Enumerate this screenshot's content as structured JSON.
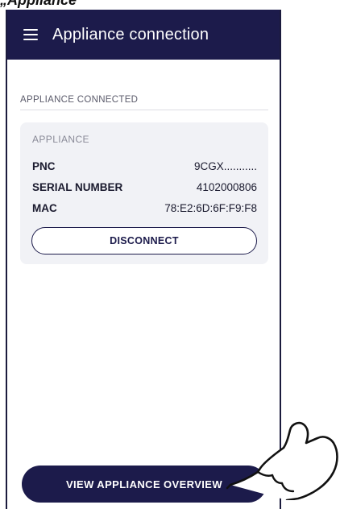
{
  "caption": "„Appliance“",
  "appbar": {
    "title": "Appliance connection",
    "menu_icon": "hamburger-menu-icon"
  },
  "section": {
    "label": "APPLIANCE CONNECTED"
  },
  "card": {
    "title": "APPLIANCE",
    "rows": [
      {
        "key": "PNC",
        "value": "9CGX..........."
      },
      {
        "key": "SERIAL NUMBER",
        "value": "4102000806"
      },
      {
        "key": "MAC",
        "value": "78:E2:6D:6F:F9:F8"
      }
    ],
    "disconnect_label": "DISCONNECT"
  },
  "footer": {
    "primary_label": "VIEW APPLIANCE OVERVIEW"
  },
  "colors": {
    "brand": "#1c1b4b",
    "card_bg": "#f1f2f6"
  },
  "overlay": {
    "icon": "pointing-hand-icon"
  }
}
